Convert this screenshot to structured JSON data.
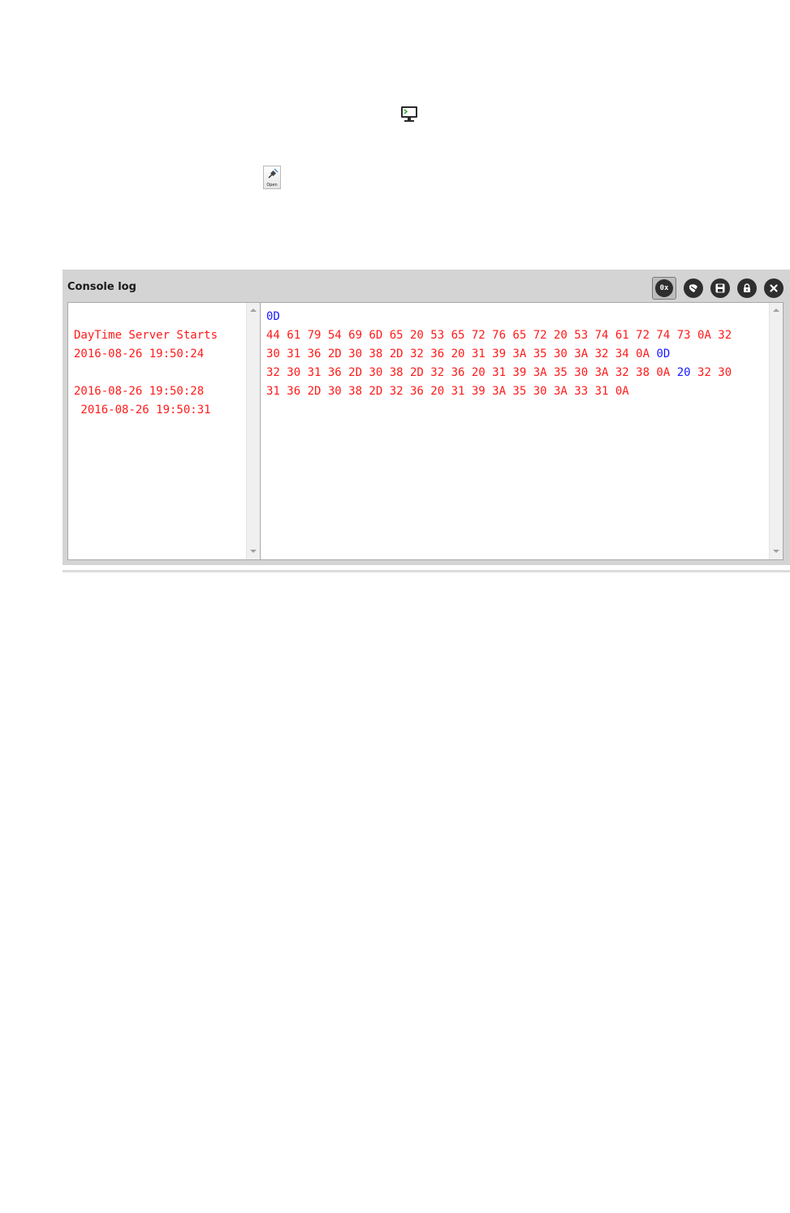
{
  "open_icon": {
    "label": "Open"
  },
  "console": {
    "title": "Console log",
    "toolbar": {
      "hex_label": "0x"
    },
    "left_pane": {
      "lines": [
        "",
        "DayTime Server Starts",
        "2016-08-26 19:50:24",
        "",
        "2016-08-26 19:50:28",
        " 2016-08-26 19:50:31"
      ]
    },
    "right_pane": {
      "lines": [
        [
          {
            "text": "0D",
            "color": "blue"
          }
        ],
        [
          {
            "text": "44 61 79 54 69 6D 65 20 53 65 72 76 65 72 20 53 74 61 72 74 73 0A 32",
            "color": "red"
          }
        ],
        [
          {
            "text": "30 31 36 2D 30 38 2D 32 36 20 31 39 3A 35 30 3A 32 34 0A ",
            "color": "red"
          },
          {
            "text": "0D",
            "color": "blue"
          }
        ],
        [
          {
            "text": "32 30 31 36 2D 30 38 2D 32 36 20 31 39 3A 35 30 3A 32 38 0A ",
            "color": "red"
          },
          {
            "text": "20",
            "color": "blue"
          },
          {
            "text": " 32 30",
            "color": "red"
          }
        ],
        [
          {
            "text": "31 36 2D 30 38 2D 32 36 20 31 39 3A 35 30 3A 33 31 0A",
            "color": "red"
          }
        ]
      ]
    },
    "colors": {
      "red": "#ff1a1a",
      "blue": "#1a1aff",
      "panel_bg": "#d4d4d4"
    }
  }
}
